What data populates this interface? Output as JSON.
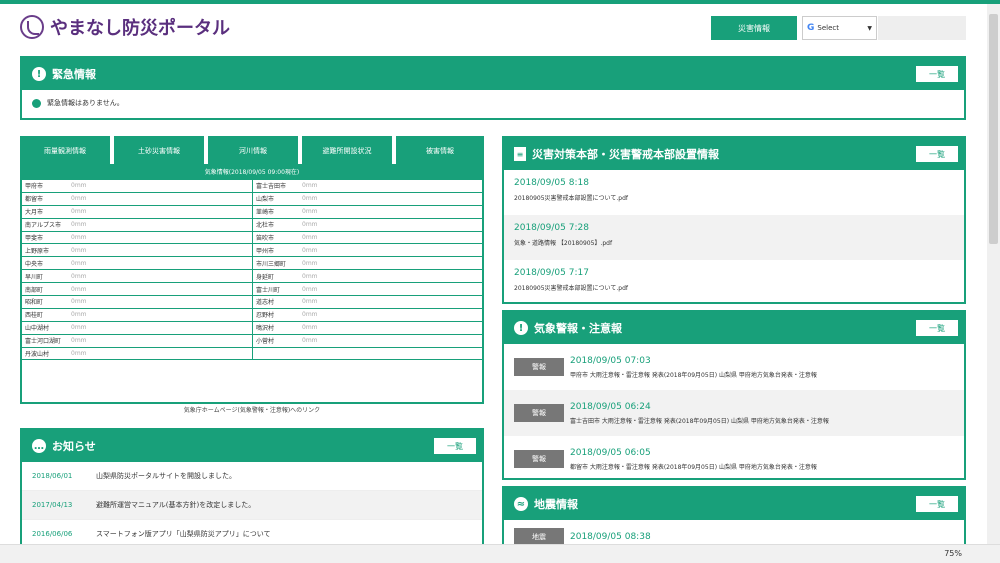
{
  "header": {
    "logo_text": "やまなし防災ポータル",
    "button_label": "災害情報",
    "lang_g": "G",
    "lang_label": "Select",
    "lang_caret": "▼"
  },
  "emergency": {
    "title": "緊急情報",
    "more": "一覧",
    "message": "緊急情報はありません。"
  },
  "tabs": [
    "雨量観測情報",
    "土砂災害情報",
    "河川情報",
    "避難所開設状況",
    "被害情報"
  ],
  "gauge": {
    "header": "気象情報(2018/09/05 09:00現在)",
    "rows": [
      [
        "甲府市",
        "0mm",
        "富士吉田市",
        "0mm"
      ],
      [
        "都留市",
        "0mm",
        "山梨市",
        "0mm"
      ],
      [
        "大月市",
        "0mm",
        "韮崎市",
        "0mm"
      ],
      [
        "南アルプス市",
        "0mm",
        "北杜市",
        "0mm"
      ],
      [
        "甲斐市",
        "0mm",
        "笛吹市",
        "0mm"
      ],
      [
        "上野原市",
        "0mm",
        "甲州市",
        "0mm"
      ],
      [
        "中央市",
        "0mm",
        "市川三郷町",
        "0mm"
      ],
      [
        "早川町",
        "0mm",
        "身延町",
        "0mm"
      ],
      [
        "南部町",
        "0mm",
        "富士川町",
        "0mm"
      ],
      [
        "昭和町",
        "0mm",
        "道志村",
        "0mm"
      ],
      [
        "西桂町",
        "0mm",
        "忍野村",
        "0mm"
      ],
      [
        "山中湖村",
        "0mm",
        "鳴沢村",
        "0mm"
      ],
      [
        "富士河口湖町",
        "0mm",
        "小菅村",
        "0mm"
      ],
      [
        "丹波山村",
        "0mm",
        "",
        ""
      ]
    ],
    "footer": "気象庁ホームページ(気象警報・注意報)へのリンク"
  },
  "news": {
    "title": "お知らせ",
    "more": "一覧",
    "items": [
      {
        "date": "2018/06/01",
        "text": "山梨県防災ポータルサイトを開設しました。"
      },
      {
        "date": "2017/04/13",
        "text": "避難所運営マニュアル(基本方針)を改定しました。"
      },
      {
        "date": "2016/06/06",
        "text": "スマートフォン版アプリ「山梨県防災アプリ」について"
      }
    ]
  },
  "hq": {
    "title": "災害対策本部・災害警戒本部設置情報",
    "more": "一覧",
    "items": [
      {
        "date": "2018/09/05 8:18",
        "file": "20180905災害警戒本部設置について.pdf"
      },
      {
        "date": "2018/09/05 7:28",
        "file": "気象・道路情報 【20180905】.pdf"
      },
      {
        "date": "2018/09/05 7:17",
        "file": "20180905災害警戒本部設置について.pdf"
      }
    ]
  },
  "warnings": {
    "title": "気象警報・注意報",
    "more": "一覧",
    "items": [
      {
        "badge": "警報",
        "date": "2018/09/05 07:03",
        "text": "甲府市 大雨注意報・雷注意報 発表(2018年09月05日) 山梨県 甲府地方気象台発表・注意報"
      },
      {
        "badge": "警報",
        "date": "2018/09/05 06:24",
        "text": "富士吉田市 大雨注意報・雷注意報 発表(2018年09月05日) 山梨県 甲府地方気象台発表・注意報"
      },
      {
        "badge": "警報",
        "date": "2018/09/05 06:05",
        "text": "都留市 大雨注意報・雷注意報 発表(2018年09月05日) 山梨県 甲府地方気象台発表・注意報"
      }
    ]
  },
  "disaster": {
    "title": "地震情報",
    "more": "一覧",
    "items": [
      {
        "badge": "地震",
        "date": "2018/09/05 08:38"
      }
    ]
  },
  "status": {
    "zoom": "75%"
  },
  "colors": {
    "accent": "#18a07a",
    "logo": "#5a2f7e"
  }
}
